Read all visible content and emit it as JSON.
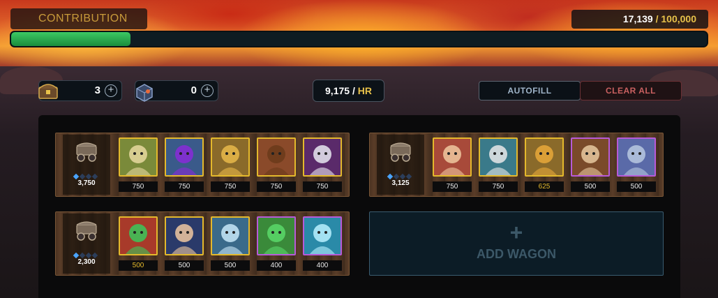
{
  "contribution": {
    "label": "CONTRIBUTION",
    "current": "17,139",
    "separator": "/",
    "max": "100,000",
    "progress_fraction": 0.17139
  },
  "resources": [
    {
      "icon": "treasure-chest-icon",
      "count": "3"
    },
    {
      "icon": "blue-crate-icon",
      "count": "0"
    }
  ],
  "rate": {
    "value": "9,175",
    "separator": "/",
    "unit": "HR"
  },
  "buttons": {
    "autofill": "AUTOFILL",
    "clear_all": "CLEAR ALL"
  },
  "wagons": [
    {
      "total": "3,750",
      "stars_filled": 1,
      "heroes": [
        {
          "name": "white-haired-hero",
          "value": "750",
          "rarity": "gold"
        },
        {
          "name": "armored-robot-hero",
          "value": "750",
          "rarity": "gold"
        },
        {
          "name": "dark-hooded-mage-hero",
          "value": "750",
          "rarity": "gold"
        },
        {
          "name": "rat-rogue-hero",
          "value": "750",
          "rarity": "gold"
        },
        {
          "name": "purple-reaper-hero",
          "value": "750",
          "rarity": "gold"
        }
      ]
    },
    {
      "total": "3,125",
      "stars_filled": 1,
      "heroes": [
        {
          "name": "red-haired-girl-hero",
          "value": "750",
          "rarity": "gold"
        },
        {
          "name": "suited-businessman-hero",
          "value": "750",
          "rarity": "gold"
        },
        {
          "name": "golden-lion-hero",
          "value": "625",
          "rarity": "gold"
        },
        {
          "name": "horned-minotaur-hero",
          "value": "500",
          "rarity": "purple"
        },
        {
          "name": "goggle-goblin-hero",
          "value": "500",
          "rarity": "purple"
        }
      ]
    },
    {
      "total": "2,300",
      "stars_filled": 1,
      "heroes": [
        {
          "name": "green-serpent-hero",
          "value": "500",
          "rarity": "gold"
        },
        {
          "name": "dark-haired-warrior-hero",
          "value": "500",
          "rarity": "gold"
        },
        {
          "name": "ice-elemental-hero",
          "value": "500",
          "rarity": "gold"
        },
        {
          "name": "leafy-treant-hero",
          "value": "400",
          "rarity": "purple"
        },
        {
          "name": "crystal-ice-hero",
          "value": "400",
          "rarity": "purple"
        }
      ]
    }
  ],
  "add_wagon": {
    "plus": "+",
    "label": "ADD WAGON"
  },
  "colors": {
    "gold_accent": "#e8c24a",
    "progress_green": "#2fb356",
    "rarity_gold": "#e4b92c",
    "rarity_purple": "#b85ad8",
    "clear_red": "#c86060"
  }
}
